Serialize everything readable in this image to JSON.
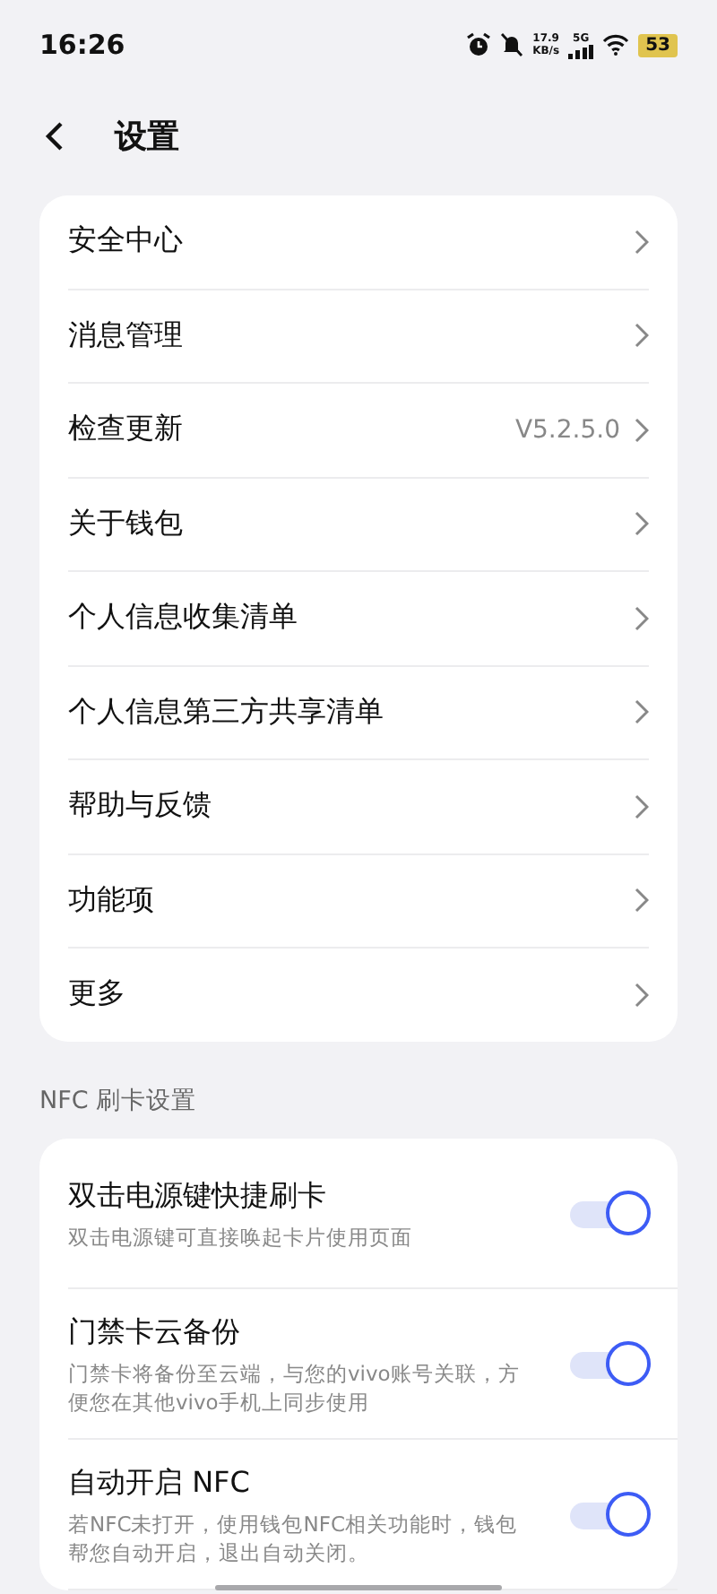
{
  "status_bar": {
    "time": "16:26",
    "speed_value": "17.9",
    "speed_unit": "KB/s",
    "network": "5G",
    "battery": "53"
  },
  "header": {
    "title": "设置"
  },
  "menu": [
    {
      "label": "安全中心"
    },
    {
      "label": "消息管理"
    },
    {
      "label": "检查更新",
      "value": "V5.2.5.0"
    },
    {
      "label": "关于钱包"
    },
    {
      "label": "个人信息收集清单"
    },
    {
      "label": "个人信息第三方共享清单"
    },
    {
      "label": "帮助与反馈"
    },
    {
      "label": "功能项"
    },
    {
      "label": "更多"
    }
  ],
  "nfc_section": {
    "title": "NFC 刷卡设置",
    "items": [
      {
        "label": "双击电源键快捷刷卡",
        "description": "双击电源键可直接唤起卡片使用页面",
        "on": true
      },
      {
        "label": "门禁卡云备份",
        "description": "门禁卡将备份至云端，与您的vivo账号关联，方便您在其他vivo手机上同步使用",
        "on": true
      },
      {
        "label": "自动开启 NFC",
        "description": "若NFC未打开，使用钱包NFC相关功能时，钱包帮您自动开启，退出自动关闭。",
        "on": true
      }
    ]
  }
}
